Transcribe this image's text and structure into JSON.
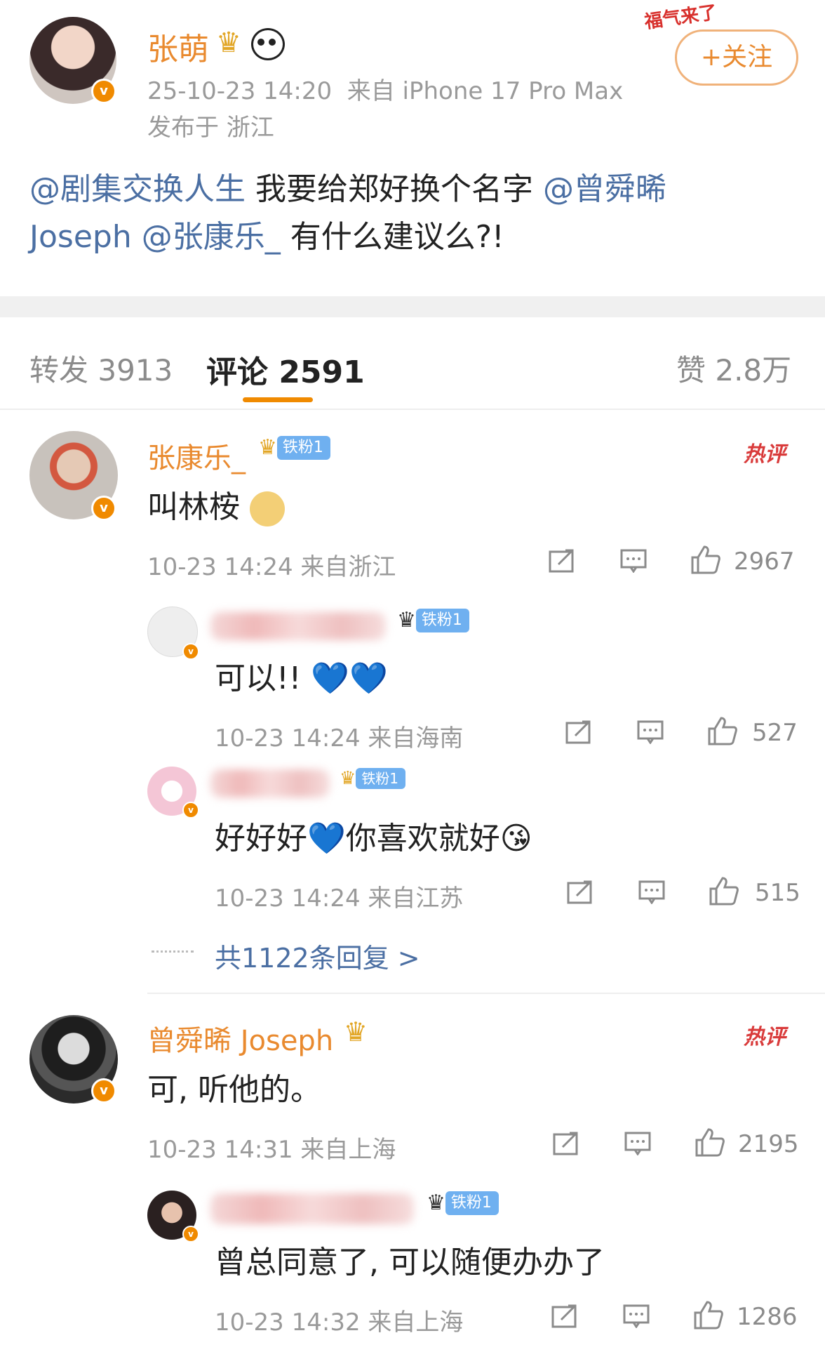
{
  "post": {
    "author": "张萌",
    "meta_line": "25-10-23 14:20  来自 iPhone 17 Pro Max",
    "location": "发布于 浙江",
    "follow_label": "+关注",
    "content_mentions": [
      "@剧集交换人生",
      "@曾舜晞",
      "@张康乐_"
    ],
    "content_text_1": " 我要给郑好换个名字 ",
    "content_text_2": "Joseph ",
    "content_text_3": " 有什么建议么?!",
    "sticker_text": "福气来了"
  },
  "tabs": {
    "repost": "转发 3913",
    "comments": "评论 2591",
    "likes": "赞 2.8万"
  },
  "comments": [
    {
      "name": "张康乐_",
      "fan_badge": "铁粉1",
      "text": "叫林桉",
      "hot": "热评",
      "meta": "10-23 14:24 来自浙江",
      "likes": "2967",
      "replies": [
        {
          "fan_badge": "铁粉1",
          "text": "可以!! 💙💙",
          "meta": "10-23 14:24 来自海南",
          "likes": "527"
        },
        {
          "fan_badge": "铁粉1",
          "text": "好好好💙你喜欢就好😘",
          "meta": "10-23 14:24 来自江苏",
          "likes": "515"
        }
      ],
      "more_replies": "共1122条回复 >"
    },
    {
      "name": "曾舜晞 Joseph",
      "text": "可, 听他的。",
      "hot": "热评",
      "meta": "10-23 14:31 来自上海",
      "likes": "2195",
      "replies": [
        {
          "fan_badge": "铁粉1",
          "text": "曾总同意了, 可以随便办办了",
          "meta": "10-23 14:32 来自上海",
          "likes": "1286"
        }
      ]
    }
  ],
  "icons": [
    "share-icon",
    "comment-icon",
    "like-icon",
    "verified-icon",
    "crown-icon",
    "panda-icon"
  ],
  "colors": {
    "accent": "#e98a2f",
    "link": "#4b6fa3",
    "fan_badge": "#6fb0f0",
    "hot": "#d93b3b"
  }
}
